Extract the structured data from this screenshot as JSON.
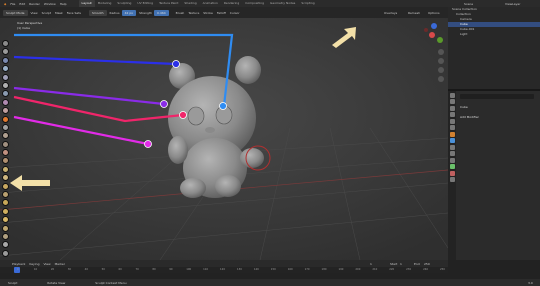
{
  "window": {
    "title": "Scene",
    "view_layer": "ViewLayer"
  },
  "menu": [
    "File",
    "Edit",
    "Render",
    "Window",
    "Help"
  ],
  "workspace_tabs": [
    {
      "label": "Layout",
      "active": true
    },
    {
      "label": "Modeling"
    },
    {
      "label": "Sculpting"
    },
    {
      "label": "UV Editing"
    },
    {
      "label": "Texture Paint"
    },
    {
      "label": "Shading"
    },
    {
      "label": "Animation"
    },
    {
      "label": "Rendering"
    },
    {
      "label": "Compositing"
    },
    {
      "label": "Geometry Nodes"
    },
    {
      "label": "Scripting"
    }
  ],
  "toolbar": {
    "mode": "Sculpt Mode",
    "menus": [
      "View",
      "Sculpt",
      "Mask",
      "Face Sets"
    ],
    "brush": "Smooth",
    "radius_label": "Radius",
    "radius_value": "42 px",
    "strength_label": "Strength",
    "strength_value": "0.464",
    "right_menus": [
      "Brush",
      "Texture",
      "Stroke",
      "Falloff",
      "Cursor"
    ],
    "overlays": "Overlays",
    "remesh": "Remesh",
    "options": "Options"
  },
  "viewport": {
    "view_name": "User Perspective",
    "object_name": "(1) Cube"
  },
  "outliner": {
    "rows": [
      {
        "label": "Scene Collection",
        "sel": false
      },
      {
        "label": "Collection",
        "sel": false
      },
      {
        "label": "Camera",
        "sel": false
      },
      {
        "label": "Cube",
        "sel": true
      },
      {
        "label": "Cube.001",
        "sel": false
      },
      {
        "label": "Light",
        "sel": false
      }
    ]
  },
  "properties": {
    "object": "Cube",
    "section": "Add Modifier"
  },
  "timeline": {
    "menus": [
      "Playback",
      "Keying",
      "View",
      "Marker"
    ],
    "current_frame": "1",
    "start_label": "Start",
    "start": "1",
    "end_label": "End",
    "end": "250",
    "ticks": [
      "0",
      "10",
      "20",
      "30",
      "40",
      "50",
      "60",
      "70",
      "80",
      "90",
      "100",
      "110",
      "120",
      "130",
      "140",
      "150",
      "160",
      "170",
      "180",
      "190",
      "200",
      "210",
      "220",
      "230",
      "240",
      "250"
    ]
  },
  "statusbar": {
    "items": [
      "Sculpt",
      "Rotate View",
      "Sculpt Context Menu"
    ],
    "version": "3.0"
  },
  "colors": {
    "line_blue": "#2f8cf2",
    "line_navy": "#2b2fe8",
    "line_purple": "#8a2be8",
    "line_red": "#f0256a",
    "line_magenta": "#e22be8",
    "highlight_arrow": "#f3e0a8",
    "selection": "#334d80"
  }
}
